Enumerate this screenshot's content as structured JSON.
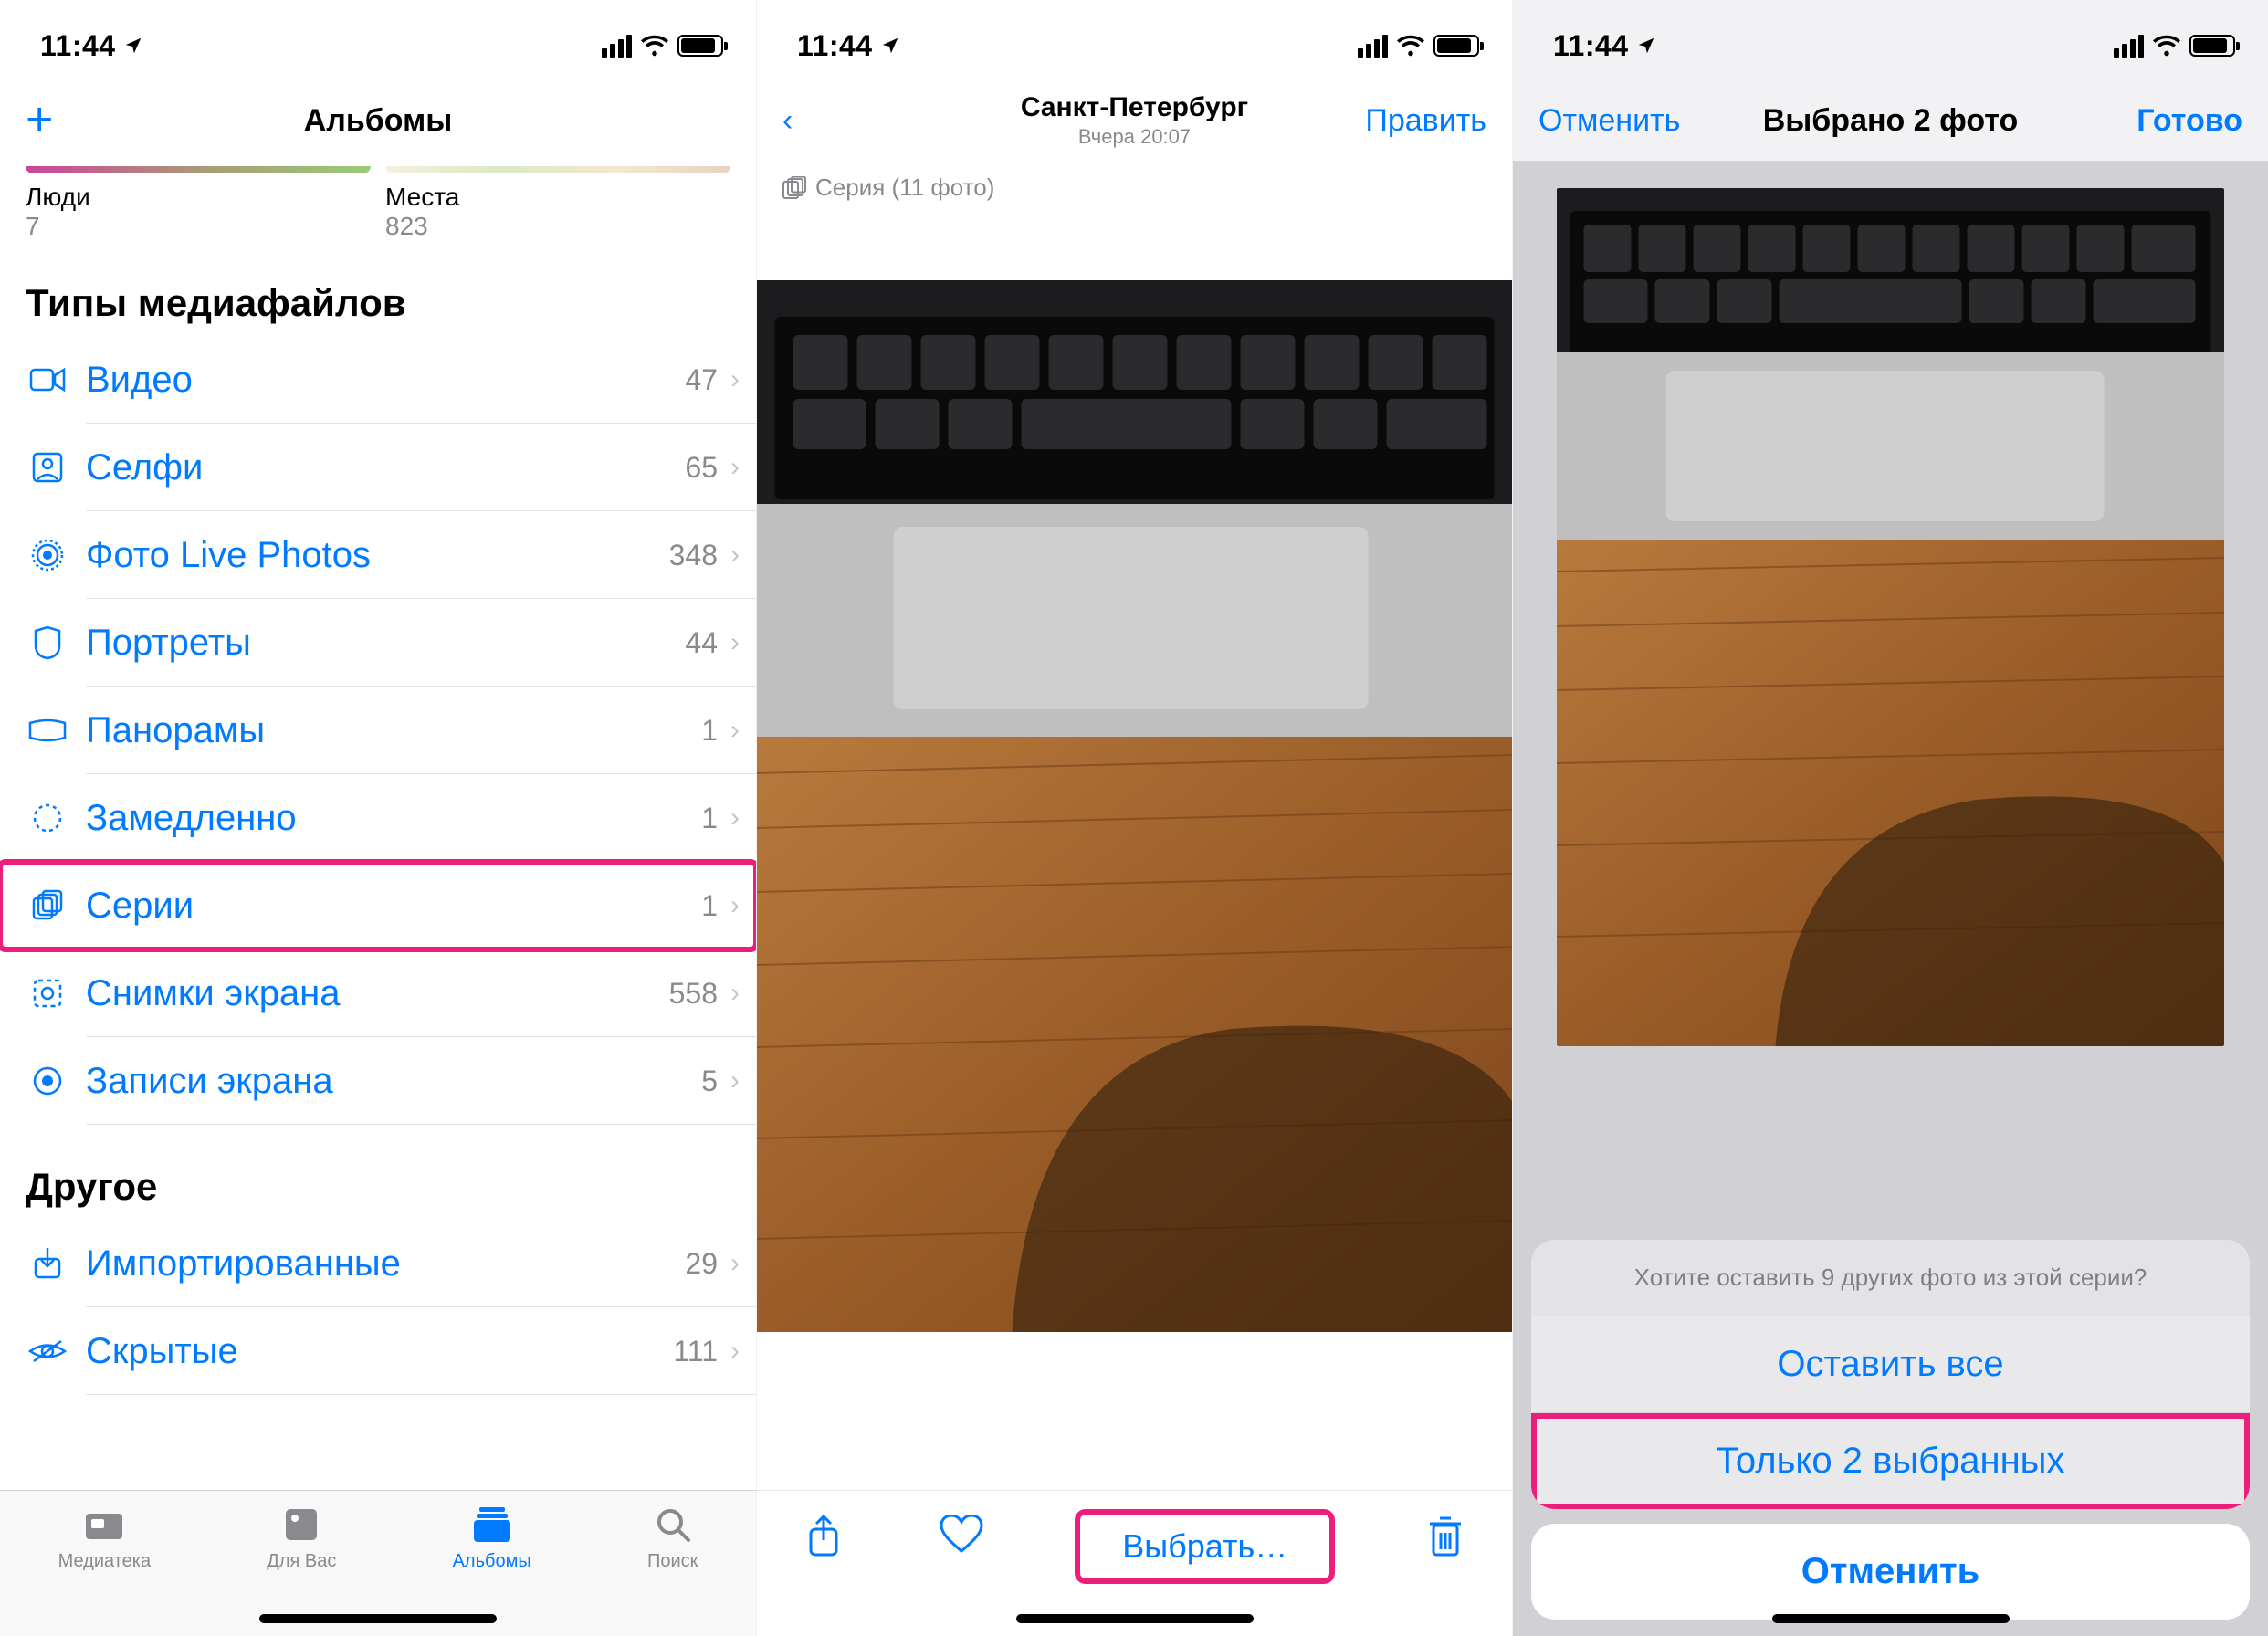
{
  "status": {
    "time": "11:44"
  },
  "pane1": {
    "nav_title": "Альбомы",
    "thumbs": [
      {
        "label": "Люди",
        "count": "7"
      },
      {
        "label": "Места",
        "count": "823"
      }
    ],
    "section_media": "Типы медиафайлов",
    "media_rows": [
      {
        "icon": "video",
        "label": "Видео",
        "count": "47"
      },
      {
        "icon": "selfie",
        "label": "Селфи",
        "count": "65"
      },
      {
        "icon": "live",
        "label": "Фото Live Photos",
        "count": "348"
      },
      {
        "icon": "portrait",
        "label": "Портреты",
        "count": "44"
      },
      {
        "icon": "pano",
        "label": "Панорамы",
        "count": "1"
      },
      {
        "icon": "slomo",
        "label": "Замедленно",
        "count": "1"
      },
      {
        "icon": "burst",
        "label": "Серии",
        "count": "1",
        "highlight": true
      },
      {
        "icon": "screenshot",
        "label": "Снимки экрана",
        "count": "558"
      },
      {
        "icon": "screenrec",
        "label": "Записи экрана",
        "count": "5"
      }
    ],
    "section_other": "Другое",
    "other_rows": [
      {
        "icon": "import",
        "label": "Импортированные",
        "count": "29"
      },
      {
        "icon": "hidden",
        "label": "Скрытые",
        "count": "111"
      }
    ],
    "tabs": [
      {
        "label": "Медиатека"
      },
      {
        "label": "Для Вас"
      },
      {
        "label": "Альбомы",
        "active": true
      },
      {
        "label": "Поиск"
      }
    ]
  },
  "pane2": {
    "title": "Санкт-Петербург",
    "subtitle": "Вчера  20:07",
    "edit": "Править",
    "burst": "Серия (11 фото)",
    "select": "Выбрать…"
  },
  "pane3": {
    "cancel_nav": "Отменить",
    "title": "Выбрано 2 фото",
    "done": "Готово",
    "sheet_msg": "Хотите оставить 9 других фото из этой серии?",
    "opt_keep_all": "Оставить все",
    "opt_keep_sel": "Только 2 выбранных",
    "sheet_cancel": "Отменить"
  }
}
